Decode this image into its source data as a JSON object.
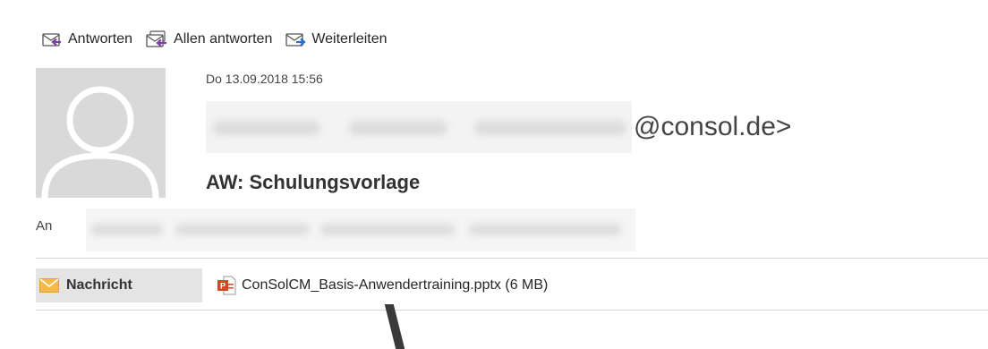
{
  "toolbar": {
    "reply_label": "Antworten",
    "reply_all_label": "Allen antworten",
    "forward_label": "Weiterleiten"
  },
  "message": {
    "date": "Do 13.09.2018 15:56",
    "sender_domain": "@consol.de>",
    "subject": "AW: Schulungsvorlage",
    "to_label": "An"
  },
  "attachments_bar": {
    "message_tab_label": "Nachricht",
    "attachment_name": "ConSolCM_Basis-Anwendertraining.pptx (6 MB)"
  },
  "colors": {
    "reply_arrow": "#7a3fa0",
    "forward_arrow": "#2b6cc4",
    "envelope": "#f6b94a",
    "pptx_icon": "#d24726"
  },
  "icons": [
    "reply-icon",
    "reply-all-icon",
    "forward-icon",
    "envelope-icon",
    "pptx-file-icon",
    "avatar-placeholder-icon"
  ]
}
